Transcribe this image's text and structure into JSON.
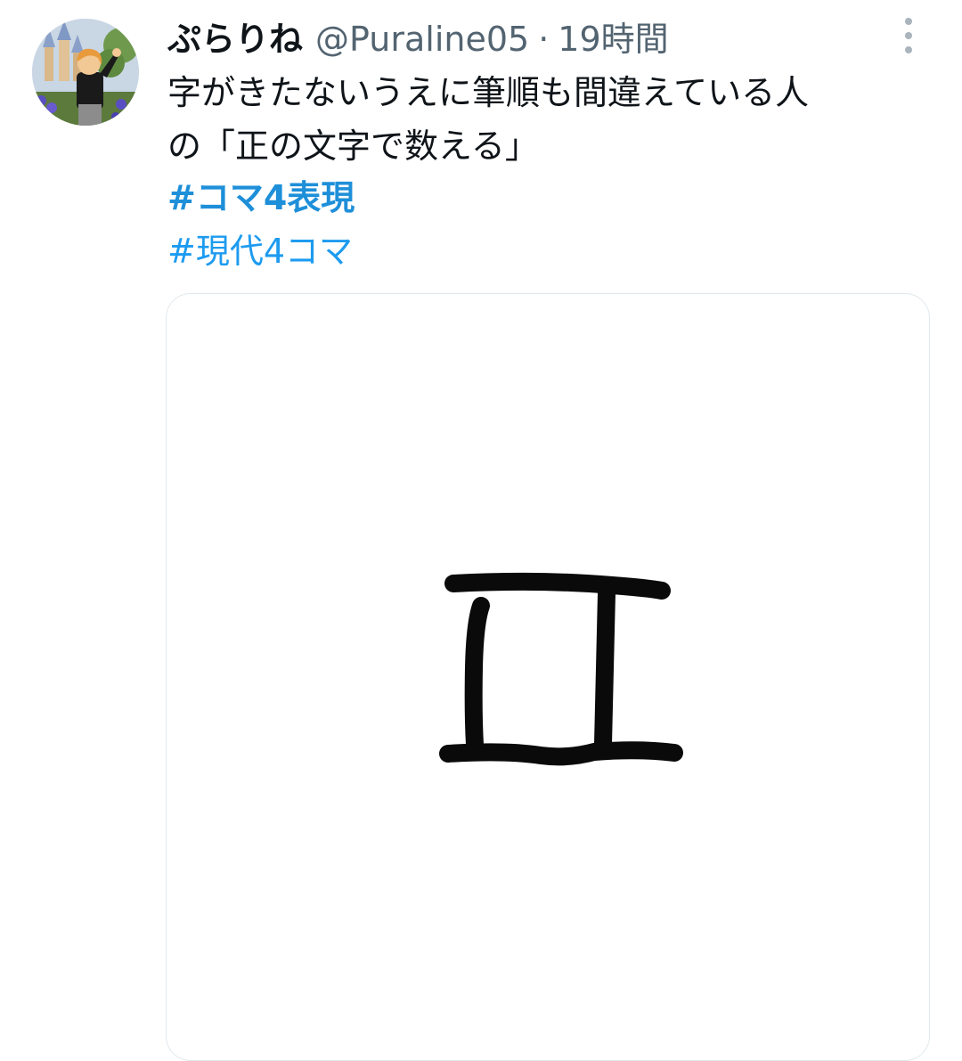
{
  "tweet": {
    "display_name": "ぷらりね",
    "handle": "@Puraline05",
    "separator": "·",
    "time": "19時間",
    "text_lines": [
      "字がきたないうえに筆順も間違えている人",
      "の「正の文字で数える」"
    ],
    "hashtags": [
      "#コマ4表現",
      "#現代4コマ"
    ],
    "more_icon": "more-vertical-icon"
  },
  "colors": {
    "hashtag": "#1d9bf0",
    "secondary_text": "#536471",
    "primary_text": "#0f1419"
  }
}
